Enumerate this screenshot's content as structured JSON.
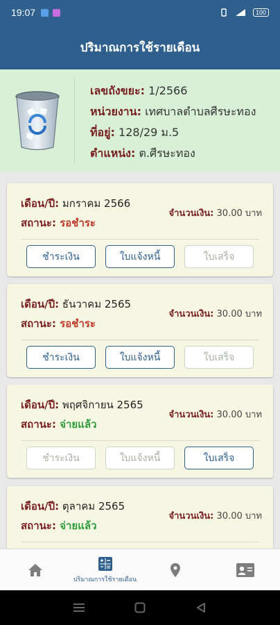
{
  "status_bar": {
    "time": "19:07",
    "battery": "100"
  },
  "header": {
    "title": "ปริมาณการใช้รายเดือน"
  },
  "info": {
    "rows": [
      {
        "label": "เลขถังขยะ:",
        "value": " 1/2566"
      },
      {
        "label": "หน่วยงาน:",
        "value": " เทศบาลตำบลศีรษะทอง"
      },
      {
        "label": "ที่อยู่:",
        "value": " 128/29 ม.5"
      },
      {
        "label": "ตำแหน่ง:",
        "value": " ต.ศีรษะทอง"
      }
    ]
  },
  "labels": {
    "month": "เดือน/ปี:",
    "status": "สถานะ:",
    "amount": "จำนวนเงิน:"
  },
  "buttons": {
    "pay": "ชำระเงิน",
    "invoice": "ใบแจ้งหนี้",
    "receipt": "ใบเสร็จ"
  },
  "bills": [
    {
      "month": " มกราคม 2566",
      "status": " รอชำระ",
      "amount": " 30.00 บาท"
    },
    {
      "month": " ธันวาคม 2565",
      "status": " รอชำระ",
      "amount": " 30.00 บาท"
    },
    {
      "month": " พฤศจิกายน 2565",
      "status": " จ่ายแล้ว",
      "amount": " 30.00 บาท"
    },
    {
      "month": " ตุลาคม 2565",
      "status": " จ่ายแล้ว",
      "amount": " 30.00 บาท"
    }
  ],
  "nav": {
    "active_label": "ปริมาณการใช้รายเดือน"
  },
  "colors": {
    "primary": "#2f5f8c",
    "pending": "#c0392b",
    "paid": "#2c9b3a",
    "info_bg": "#d8f0d6",
    "card_bg": "#f5f7e3"
  }
}
